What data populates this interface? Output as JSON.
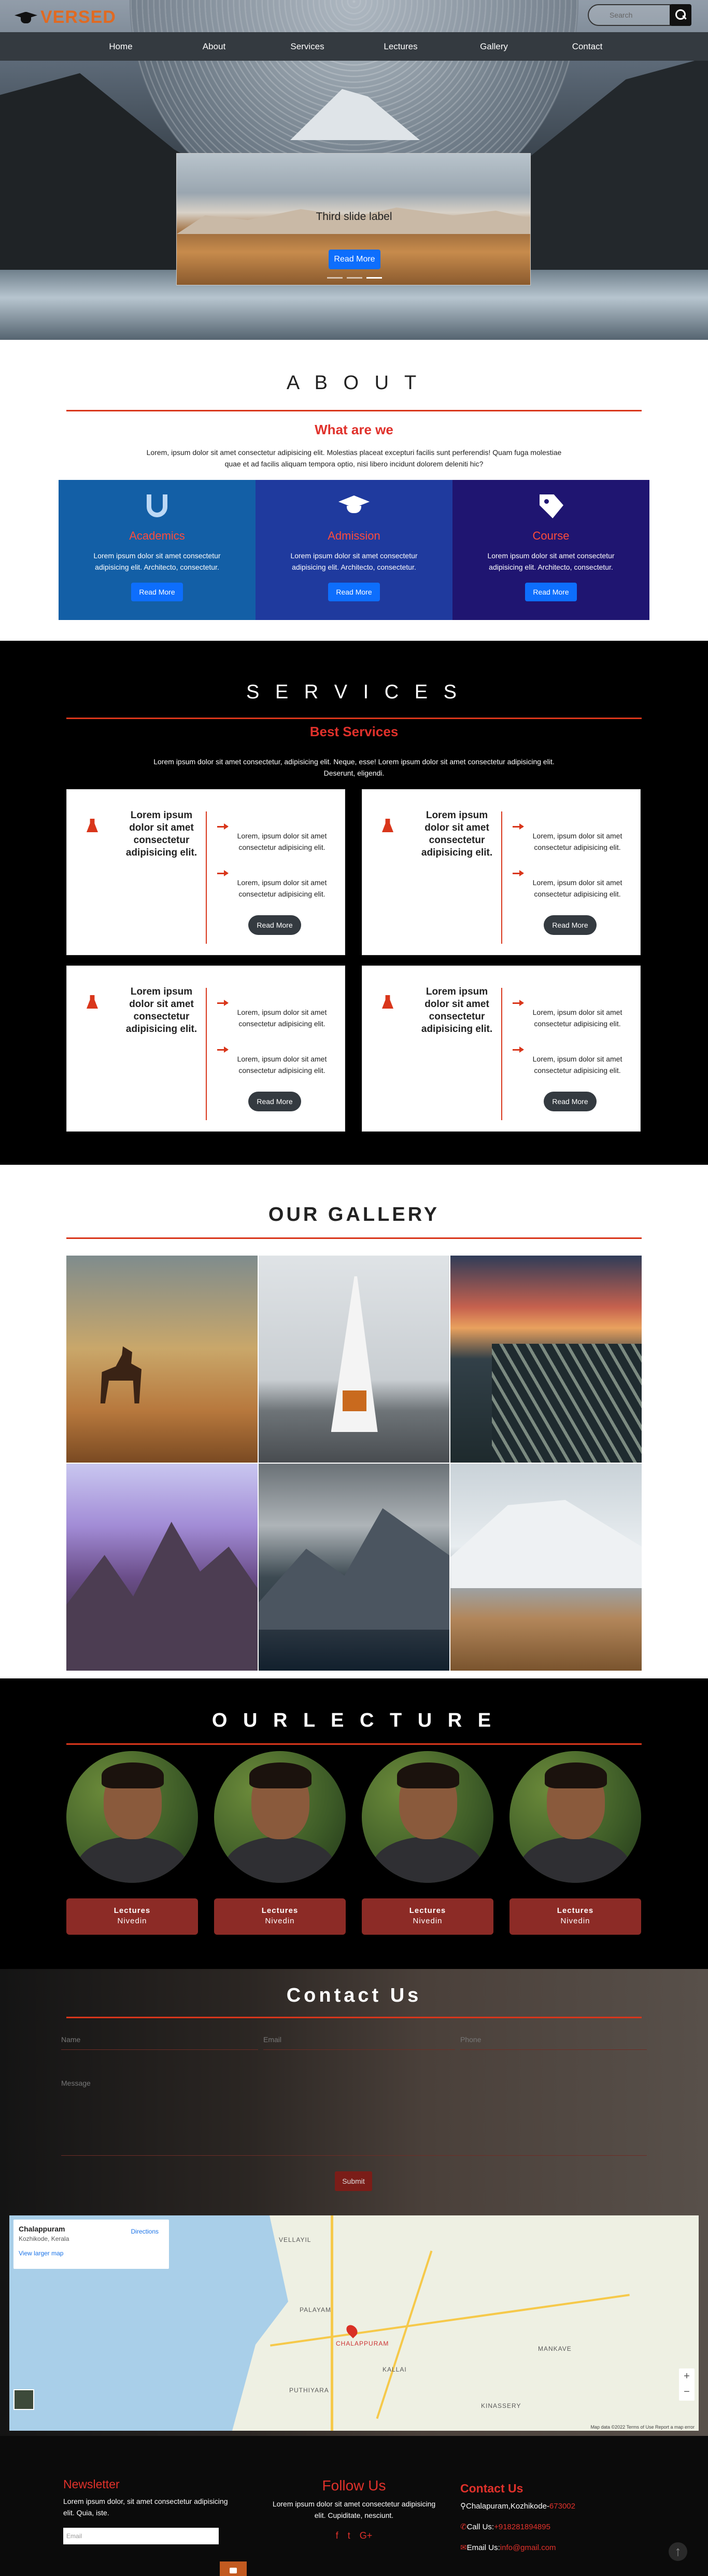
{
  "header": {
    "logo_text": "VERSED",
    "search_placeholder": "Search",
    "nav": [
      "Home",
      "About",
      "Services",
      "Lectures",
      "Gallery",
      "Contact"
    ]
  },
  "carousel": {
    "label": "Third slide label",
    "button": "Read More",
    "slides": 3,
    "active_slide": 3
  },
  "about": {
    "title": "A B O U T",
    "subtitle": "What are we",
    "text": "Lorem, ipsum dolor sit amet consectetur adipisicing elit. Molestias placeat excepturi facilis sunt perferendis! Quam fuga molestiae quae et ad facilis aliquam tempora optio, nisi libero incidunt dolorem deleniti hic?",
    "cards": [
      {
        "icon": "magnet-icon",
        "title": "Academics",
        "text": "Lorem ipsum dolor sit amet consectetur adipisicing elit. Architecto, consectetur.",
        "button": "Read More",
        "color": "#135fa6"
      },
      {
        "icon": "graduation-cap-icon",
        "title": "Admission",
        "text": "Lorem ipsum dolor sit amet consectetur adipisicing elit. Architecto, consectetur.",
        "button": "Read More",
        "color": "#1f3a9e"
      },
      {
        "icon": "tag-icon",
        "title": "Course",
        "text": "Lorem ipsum dolor sit amet consectetur adipisicing elit. Architecto, consectetur.",
        "button": "Read More",
        "color": "#1f1571"
      }
    ]
  },
  "services": {
    "title": "S E R V I C E S",
    "subtitle": "Best Services",
    "text": "Lorem ipsum dolor sit amet consectetur, adipisicing elit. Neque, esse! Lorem ipsum dolor sit amet consectetur adipisicing elit. Deserunt, eligendi.",
    "items": [
      {
        "heading": "Lorem ipsum dolor sit amet consectetur adipisicing elit.",
        "line1": "Lorem, ipsum dolor sit amet consectetur adipisicing elit.",
        "line2": "Lorem, ipsum dolor sit amet consectetur adipisicing elit.",
        "button": "Read More"
      },
      {
        "heading": "Lorem ipsum dolor sit amet consectetur adipisicing elit.",
        "line1": "Lorem, ipsum dolor sit amet consectetur adipisicing elit.",
        "line2": "Lorem, ipsum dolor sit amet consectetur adipisicing elit.",
        "button": "Read More"
      },
      {
        "heading": "Lorem ipsum dolor sit amet consectetur adipisicing elit.",
        "line1": "Lorem, ipsum dolor sit amet consectetur adipisicing elit.",
        "line2": "Lorem, ipsum dolor sit amet consectetur adipisicing elit.",
        "button": "Read More"
      },
      {
        "heading": "Lorem ipsum dolor sit amet consectetur adipisicing elit.",
        "line1": "Lorem, ipsum dolor sit amet consectetur adipisicing elit.",
        "line2": "Lorem, ipsum dolor sit amet consectetur adipisicing elit.",
        "button": "Read More"
      }
    ]
  },
  "gallery": {
    "title": "OUR GALLERY"
  },
  "lecture": {
    "title": "O U R   L E C T U R E",
    "people": [
      {
        "role": "Lectures",
        "name": "Nivedin"
      },
      {
        "role": "Lectures",
        "name": "Nivedin"
      },
      {
        "role": "Lectures",
        "name": "Nivedin"
      },
      {
        "role": "Lectures",
        "name": "Nivedin"
      }
    ]
  },
  "contact": {
    "title": "Contact Us",
    "name_placeholder": "Name",
    "email_placeholder": "Email",
    "phone_placeholder": "Phone",
    "message_placeholder": "Message",
    "submit": "Submit",
    "map": {
      "place": "Chalappuram",
      "address": "Kozhikode, Kerala",
      "directions": "Directions",
      "larger_map": "View larger map",
      "footer": "Map data ©2022   Terms of Use   Report a map error",
      "labels": [
        "CHALAPPURAM",
        "KALLAI",
        "PALAYAM",
        "PUTHIYARA",
        "VELLAYIL",
        "MANKAVE",
        "KINASSERY"
      ]
    }
  },
  "footer": {
    "newsletter_title": "Newsletter",
    "newsletter_text": "Lorem ipsum dolor, sit amet consectetur adipisicing elit. Quia, iste.",
    "newsletter_placeholder": "Email",
    "follow_title": "Follow Us",
    "follow_text": "Lorem ipsum dolor sit amet consectetur adipisicing elit. Cupiditate, nesciunt.",
    "social": [
      "f",
      "t",
      "G+"
    ],
    "contact_title": "Contact Us",
    "address": "Chalapuram,Kozhikode-",
    "pin": "673002",
    "call_label": "Call Us:",
    "phone": "+918281894895",
    "email_label": "Email Us:",
    "email": "info@gmail.com"
  }
}
